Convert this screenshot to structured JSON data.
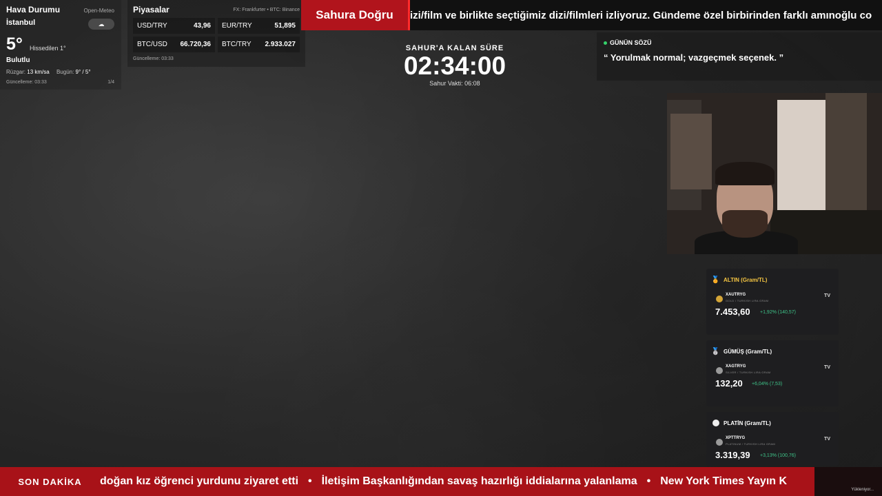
{
  "weather": {
    "title": "Hava Durumu",
    "source": "Open-Meteo",
    "city": "İstanbul",
    "icon": "cloud-icon",
    "icon_glyph": "☁",
    "temp": "5°",
    "feels": "Hissedilen 1°",
    "condition": "Bulutlu",
    "wind_label": "Rüzgar:",
    "wind_value": "13 km/sa",
    "today_label": "Bugün:",
    "today_value": "9° / 5°",
    "updated": "Güncelleme: 03:33",
    "page": "1/4"
  },
  "markets": {
    "title": "Piyasalar",
    "source": "FX: Frankfurter • BTC: Binance",
    "items": [
      {
        "pair": "USD/TRY",
        "value": "43,96"
      },
      {
        "pair": "EUR/TRY",
        "value": "51,895"
      },
      {
        "pair": "BTC/USD",
        "value": "66.720,36"
      },
      {
        "pair": "BTC/TRY",
        "value": "2.933.027"
      }
    ],
    "updated": "Güncelleme: 03:33"
  },
  "top_ticker": {
    "label": "Sahura Doğru",
    "text": "izi/film ve birlikte seçtiğimiz dizi/filmleri izliyoruz. Gündeme özel birbirinden farklı amınoğlu co"
  },
  "countdown": {
    "label": "SAHUR'A KALAN SÜRE",
    "time": "02:34:00",
    "sub": "Sahur Vakti: 06:08"
  },
  "quote": {
    "label": "GÜNÜN SÖZÜ",
    "text": "“ Yorulmak normal; vazgeçmek seçenek. ”"
  },
  "metals": [
    {
      "name": "ALTIN (Gram/TL)",
      "name_color": "#f5c542",
      "icon": "medal-icon",
      "symbol": "XAUTRYG",
      "sub": "GOLD / TURKISH LIRA GRAM",
      "tv": "TV",
      "price": "7.453,60",
      "change": "+1,92% (140,57)",
      "sym_color": "#d4a537"
    },
    {
      "name": "GÜMÜŞ (Gram/TL)",
      "name_color": "#ffffff",
      "icon": "medal-icon",
      "symbol": "XAGTRYG",
      "sub": "SILVER / TURKISH LIRA GRAM",
      "tv": "TV",
      "price": "132,20",
      "change": "+6,04% (7,53)",
      "sym_color": "#9a9a9a"
    },
    {
      "name": "PLATİN (Gram/TL)",
      "name_color": "#ffffff",
      "icon": "circle-icon",
      "symbol": "XPTTRYG",
      "sub": "PLATINUM / TURKISH LIRA GRAM",
      "tv": "TV",
      "price": "3.319,39",
      "change": "+3,13% (100,76)",
      "sym_color": "#9a9a9a"
    }
  ],
  "bottom_ticker": {
    "label": "SON DAKİKA",
    "items": [
      "doğan kız öğrenci yurdunu ziyaret etti",
      "İletişim Başkanlığından savaş hazırlığı iddialarına yalanlama",
      "New York Times Yayın K"
    ],
    "loading": "Yükleniyor..."
  }
}
